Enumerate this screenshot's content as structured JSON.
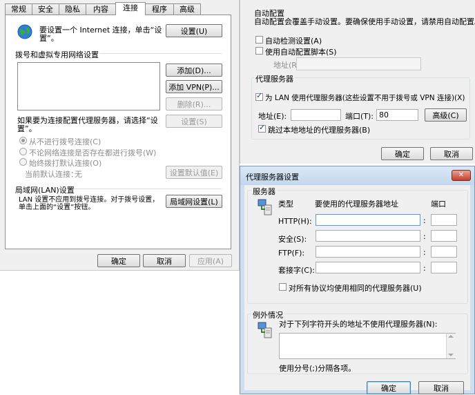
{
  "left_dialog": {
    "tabs": [
      "常规",
      "安全",
      "隐私",
      "内容",
      "连接",
      "程序",
      "高级"
    ],
    "active_tab": "连接",
    "setup_text": "要设置一个 Internet 连接，单击“设置”。",
    "setup_button": "设置(U)",
    "dialup_title": "拨号和虚拟专用网络设置",
    "add_button": "添加(D)...",
    "add_vpn_button": "添加 VPN(P)...",
    "delete_button": "删除(R)...",
    "proxy_prompt": "如果要为连接配置代理服务器，请选择“设置”。",
    "settings_button": "设置(S)",
    "radio_never": "从不进行拨号连接(C)",
    "radio_when_no_network": "不论网络连接是否存在都进行拨号(W)",
    "radio_always": "始终拨打默认连接(O)",
    "current_default_label": "当前默认连接：",
    "current_default_value": "无",
    "set_default_button": "设置默认值(E)",
    "lan_title": "局域网(LAN)设置",
    "lan_text": "LAN 设置不应用到拨号连接。对于拨号设置，单击上面的“设置”按钮。",
    "lan_button": "局域网设置(L)",
    "ok": "确定",
    "cancel": "取消",
    "apply": "应用(A)"
  },
  "lan_dialog": {
    "auto_title": "自动配置",
    "auto_desc": "自动配置会覆盖手动设置。要确保使用手动设置，请禁用自动配置。",
    "auto_detect": "自动检测设置(A)",
    "auto_detect_checked": false,
    "use_script": "使用自动配置脚本(S)",
    "use_script_checked": false,
    "address_label": "地址(R)",
    "address_value": "",
    "proxy_title": "代理服务器",
    "use_proxy": "为 LAN 使用代理服务器(这些设置不用于拨号或 VPN 连接)(X)",
    "use_proxy_checked": true,
    "proxy_address_label": "地址(E):",
    "proxy_address_value": "",
    "port_label": "端口(T):",
    "port_value": "80",
    "advanced_button": "高级(C)",
    "bypass_local": "跳过本地地址的代理服务器(B)",
    "bypass_local_checked": true,
    "ok": "确定",
    "cancel": "取消"
  },
  "proxy_dialog": {
    "title": "代理服务器设置",
    "servers_title": "服务器",
    "col_type": "类型",
    "col_address": "要使用的代理服务器地址",
    "col_port": "端口",
    "rows": [
      {
        "label": "HTTP(H):",
        "address": "",
        "port": ""
      },
      {
        "label": "安全(S):",
        "address": "",
        "port": ""
      },
      {
        "label": "FTP(F):",
        "address": "",
        "port": ""
      },
      {
        "label": "套接字(C):",
        "address": "",
        "port": ""
      }
    ],
    "same_proxy": "对所有协议均使用相同的代理服务器(U)",
    "same_proxy_checked": false,
    "exceptions_title": "例外情况",
    "exceptions_desc": "对于下列字符开头的地址不使用代理服务器(N):",
    "exceptions_value": "",
    "exceptions_hint": "使用分号(;)分隔各项。",
    "ok": "确定",
    "cancel": "取消",
    "close_glyph": "✕"
  }
}
